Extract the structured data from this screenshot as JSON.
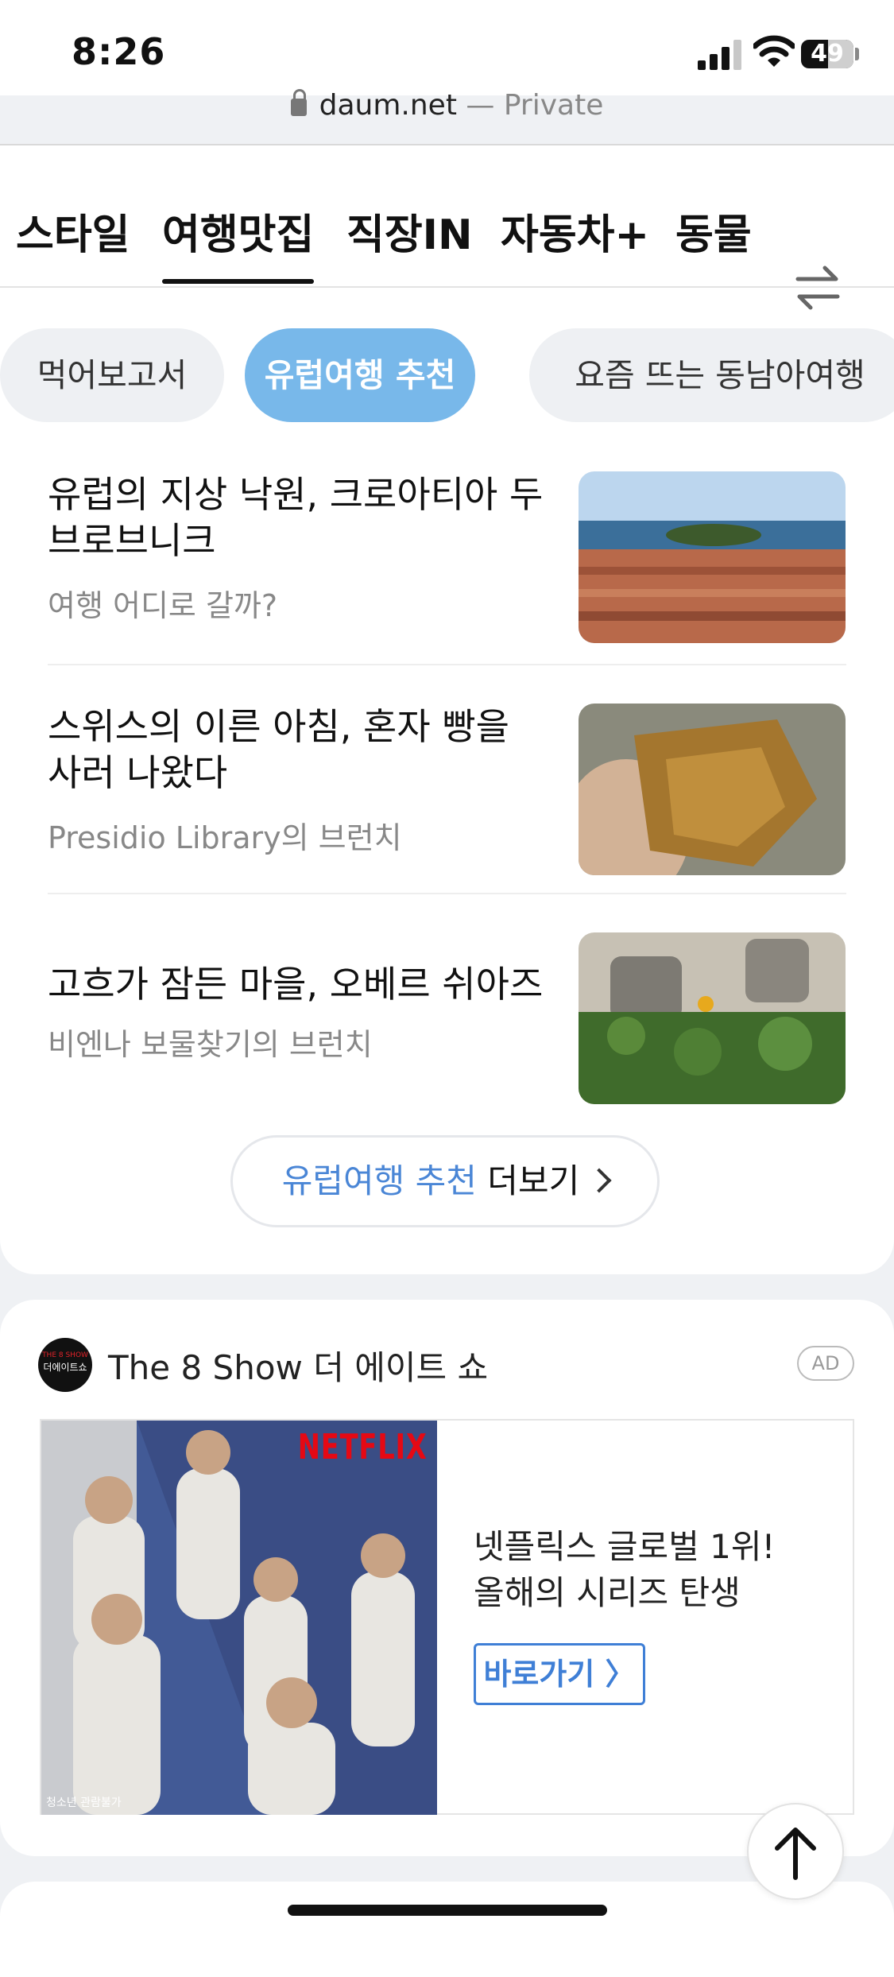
{
  "status_bar": {
    "time": "8:26",
    "battery": "49"
  },
  "browser": {
    "domain": "daum.net",
    "mode": " — Private"
  },
  "tabs": [
    {
      "label": "스타일"
    },
    {
      "label": "여행맛집",
      "active": true
    },
    {
      "label": "직장IN"
    },
    {
      "label": "자동차+"
    },
    {
      "label": "동물"
    }
  ],
  "chips": [
    {
      "label": "먹어보고서"
    },
    {
      "label": "유럽여행 추천",
      "active": true
    },
    {
      "label": "요즘 뜨는 동남아여행"
    }
  ],
  "articles": [
    {
      "title": "유럽의 지상 낙원, 크로아티아 두브로브니크",
      "source": "여행 어디로 갈까?"
    },
    {
      "title": "스위스의 이른 아침, 혼자 빵을 사러 나왔다",
      "source": "Presidio Library의 브런치"
    },
    {
      "title": "고흐가 잠든 마을, 오베르 쉬아즈",
      "source": "비엔나 보물찾기의 브런치"
    }
  ],
  "more_button": {
    "highlight": "유럽여행 추천",
    "rest": " 더보기"
  },
  "ad": {
    "advertiser": "The 8 Show 더 에이트 쇼",
    "badge": "AD",
    "logo_top": "THE 8 SHOW",
    "logo_text": "더에이트쇼",
    "poster_brand": "NETFLIX",
    "poster_rating": "청소년 관람불가",
    "headline_line1": "넷플릭스 글로벌 1위!",
    "headline_line2": "올해의 시리즈 탄생",
    "cta": "바로가기 〉"
  },
  "colors": {
    "accent_chip": "#78b8ea",
    "link_blue": "#4a86d6",
    "netflix_red": "#e50914"
  },
  "icons": [
    "lock-icon",
    "swap-icon",
    "chevron-right-icon",
    "arrow-up-icon",
    "wifi-icon",
    "signal-icon",
    "battery-icon"
  ]
}
